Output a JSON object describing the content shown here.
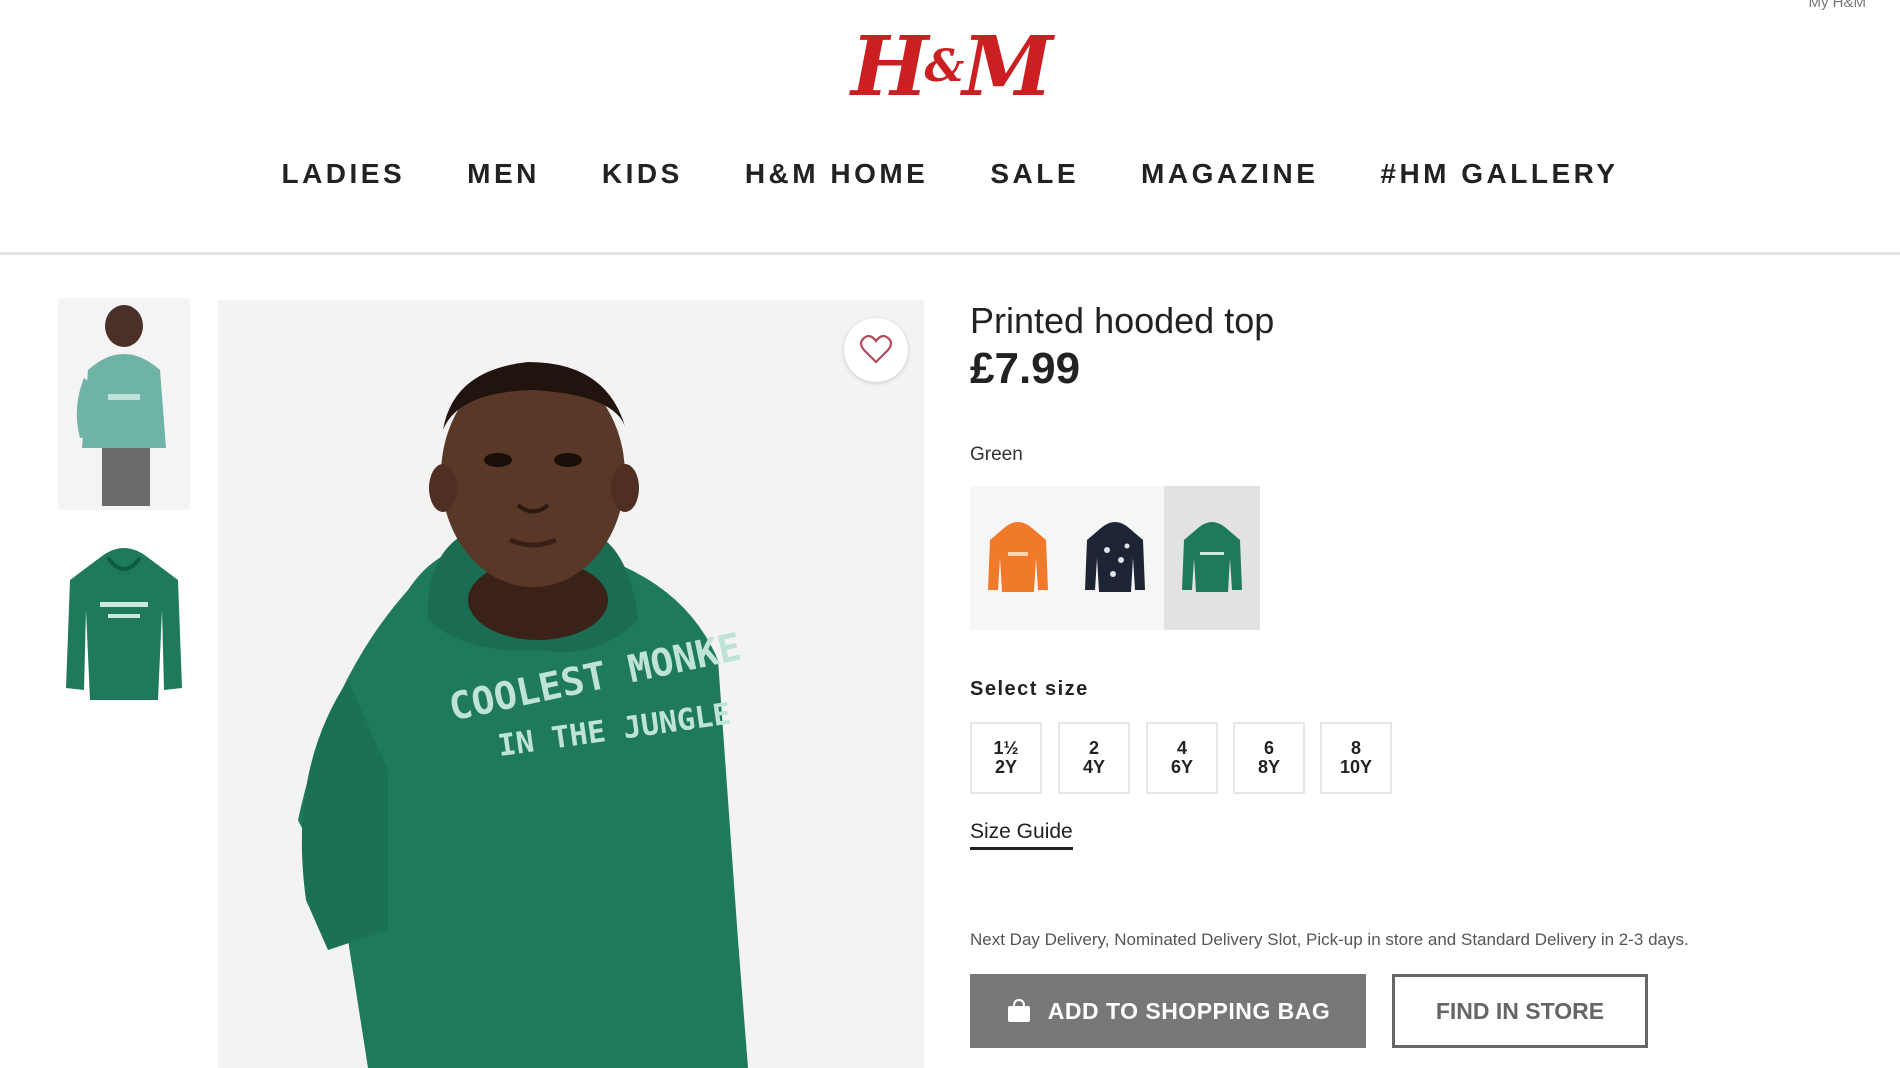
{
  "header": {
    "account_link": "My H&M",
    "logo_text": {
      "left": "H",
      "amp": "&",
      "right": "M"
    },
    "brand_color": "#cc1f21"
  },
  "nav": {
    "items": [
      "LADIES",
      "MEN",
      "KIDS",
      "H&M HOME",
      "SALE",
      "MAGAZINE",
      "#HM GALLERY"
    ]
  },
  "gallery": {
    "thumbnail_count": 2,
    "hoodie_print": {
      "line1": "COOLEST MONKE",
      "line2": "IN THE JUNGLE"
    },
    "favourite_icon": "heart-icon"
  },
  "product": {
    "title": "Printed hooded top",
    "price": "£7.99",
    "color_label": "Green",
    "colors": [
      {
        "name": "orange",
        "hex": "#f07a2a"
      },
      {
        "name": "navy",
        "hex": "#1c2436"
      },
      {
        "name": "green",
        "hex": "#1f7a5c",
        "selected": true
      }
    ],
    "size_label": "Select size",
    "sizes": [
      {
        "line1": "1½",
        "line2": "2Y"
      },
      {
        "line1": "2",
        "line2": "4Y"
      },
      {
        "line1": "4",
        "line2": "6Y"
      },
      {
        "line1": "6",
        "line2": "8Y"
      },
      {
        "line1": "8",
        "line2": "10Y"
      }
    ],
    "size_guide": "Size Guide",
    "delivery_info": "Next Day Delivery, Nominated Delivery Slot, Pick-up in store and Standard Delivery in 2-3 days.",
    "add_to_bag": "ADD TO SHOPPING BAG",
    "add_to_bag_icon": "shopping-bag-icon",
    "find_in_store": "FIND IN STORE"
  }
}
